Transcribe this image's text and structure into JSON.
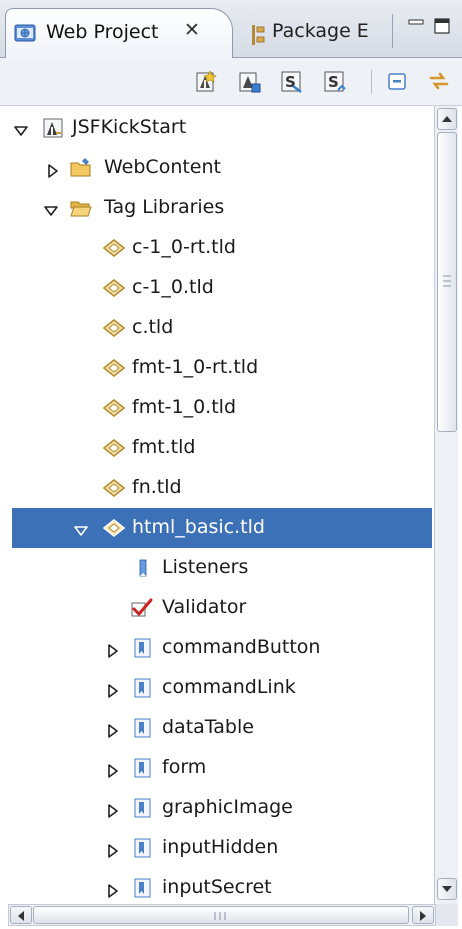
{
  "tabs": {
    "active": {
      "label": "Web Project",
      "close_glyph": "✕",
      "icon": "web-project-icon"
    },
    "inactive": {
      "label": "Package E",
      "icon": "package-explorer-icon"
    },
    "minimize_icon": "minimize-icon",
    "maximize_icon": "maximize-icon"
  },
  "toolbar": {
    "buttons": [
      {
        "name": "new-web-project-icon"
      },
      {
        "name": "new-project-icon"
      },
      {
        "name": "filter-icon"
      },
      {
        "name": "sync-icon"
      },
      {
        "name": "collapse-all-icon"
      },
      {
        "name": "link-with-editor-icon"
      }
    ]
  },
  "tree": {
    "rows": [
      {
        "label": "JSFKickStart",
        "expander": "expanded",
        "icon": "project-icon"
      },
      {
        "label": "WebContent",
        "expander": "collapsed",
        "icon": "folder-icon"
      },
      {
        "label": "Tag Libraries",
        "expander": "expanded",
        "icon": "folder-open-icon"
      },
      {
        "label": "c-1_0-rt.tld",
        "expander": "none",
        "icon": "tld-file-icon"
      },
      {
        "label": "c-1_0.tld",
        "expander": "none",
        "icon": "tld-file-icon"
      },
      {
        "label": "c.tld",
        "expander": "none",
        "icon": "tld-file-icon"
      },
      {
        "label": "fmt-1_0-rt.tld",
        "expander": "none",
        "icon": "tld-file-icon"
      },
      {
        "label": "fmt-1_0.tld",
        "expander": "none",
        "icon": "tld-file-icon"
      },
      {
        "label": "fmt.tld",
        "expander": "none",
        "icon": "tld-file-icon"
      },
      {
        "label": "fn.tld",
        "expander": "none",
        "icon": "tld-file-icon"
      },
      {
        "label": "html_basic.tld",
        "expander": "expanded",
        "icon": "tld-file-icon",
        "selected": true
      },
      {
        "label": "Listeners",
        "expander": "none",
        "icon": "listeners-icon"
      },
      {
        "label": "Validator",
        "expander": "none",
        "icon": "validator-check-icon"
      },
      {
        "label": "commandButton",
        "expander": "collapsed",
        "icon": "tag-icon"
      },
      {
        "label": "commandLink",
        "expander": "collapsed",
        "icon": "tag-icon"
      },
      {
        "label": "dataTable",
        "expander": "collapsed",
        "icon": "tag-icon"
      },
      {
        "label": "form",
        "expander": "collapsed",
        "icon": "tag-icon"
      },
      {
        "label": "graphicImage",
        "expander": "collapsed",
        "icon": "tag-icon"
      },
      {
        "label": "inputHidden",
        "expander": "collapsed",
        "icon": "tag-icon"
      },
      {
        "label": "inputSecret",
        "expander": "collapsed",
        "icon": "tag-icon"
      }
    ]
  },
  "colors": {
    "selection": "#3d71b7",
    "selection_text": "#ffffff",
    "tab_bar": "#dfe3ea",
    "folder": "#e8b84a",
    "tld": "#d6a23c",
    "tag": "#4a7fc8",
    "check": "#cc2222"
  }
}
